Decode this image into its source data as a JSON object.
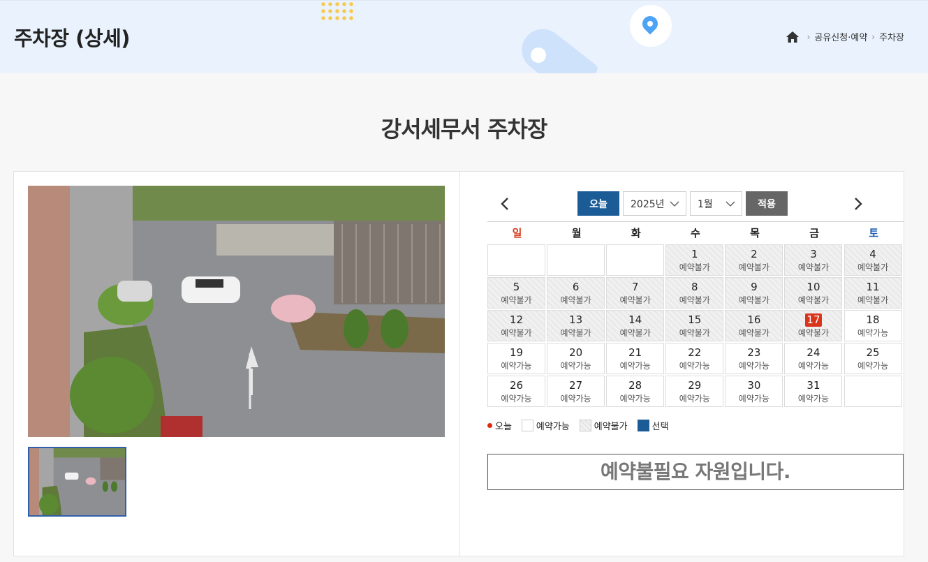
{
  "header": {
    "title": "주차장 (상세)",
    "breadcrumb": [
      "공유신청·예약",
      "주차장"
    ]
  },
  "section_title": "강서세무서 주차장",
  "calendar": {
    "today_label": "오늘",
    "year_value": "2025년",
    "month_value": "1월",
    "apply_label": "적용",
    "weekdays": [
      "일",
      "월",
      "화",
      "수",
      "목",
      "금",
      "토"
    ],
    "today_day": 17,
    "cells": [
      {
        "day": "",
        "status": ""
      },
      {
        "day": "",
        "status": ""
      },
      {
        "day": "",
        "status": ""
      },
      {
        "day": "1",
        "status": "예약불가"
      },
      {
        "day": "2",
        "status": "예약불가"
      },
      {
        "day": "3",
        "status": "예약불가"
      },
      {
        "day": "4",
        "status": "예약불가"
      },
      {
        "day": "5",
        "status": "예약불가"
      },
      {
        "day": "6",
        "status": "예약불가"
      },
      {
        "day": "7",
        "status": "예약불가"
      },
      {
        "day": "8",
        "status": "예약불가"
      },
      {
        "day": "9",
        "status": "예약불가"
      },
      {
        "day": "10",
        "status": "예약불가"
      },
      {
        "day": "11",
        "status": "예약불가"
      },
      {
        "day": "12",
        "status": "예약불가"
      },
      {
        "day": "13",
        "status": "예약불가"
      },
      {
        "day": "14",
        "status": "예약불가"
      },
      {
        "day": "15",
        "status": "예약불가"
      },
      {
        "day": "16",
        "status": "예약불가"
      },
      {
        "day": "17",
        "status": "예약불가"
      },
      {
        "day": "18",
        "status": "예약가능"
      },
      {
        "day": "19",
        "status": "예약가능"
      },
      {
        "day": "20",
        "status": "예약가능"
      },
      {
        "day": "21",
        "status": "예약가능"
      },
      {
        "day": "22",
        "status": "예약가능"
      },
      {
        "day": "23",
        "status": "예약가능"
      },
      {
        "day": "24",
        "status": "예약가능"
      },
      {
        "day": "25",
        "status": "예약가능"
      },
      {
        "day": "26",
        "status": "예약가능"
      },
      {
        "day": "27",
        "status": "예약가능"
      },
      {
        "day": "28",
        "status": "예약가능"
      },
      {
        "day": "29",
        "status": "예약가능"
      },
      {
        "day": "30",
        "status": "예약가능"
      },
      {
        "day": "31",
        "status": "예약가능"
      },
      {
        "day": "",
        "status": ""
      }
    ]
  },
  "legend": {
    "today": "오늘",
    "available": "예약가능",
    "unavailable": "예약불가",
    "selected": "선택"
  },
  "notice": "예약불필요 자원입니다."
}
